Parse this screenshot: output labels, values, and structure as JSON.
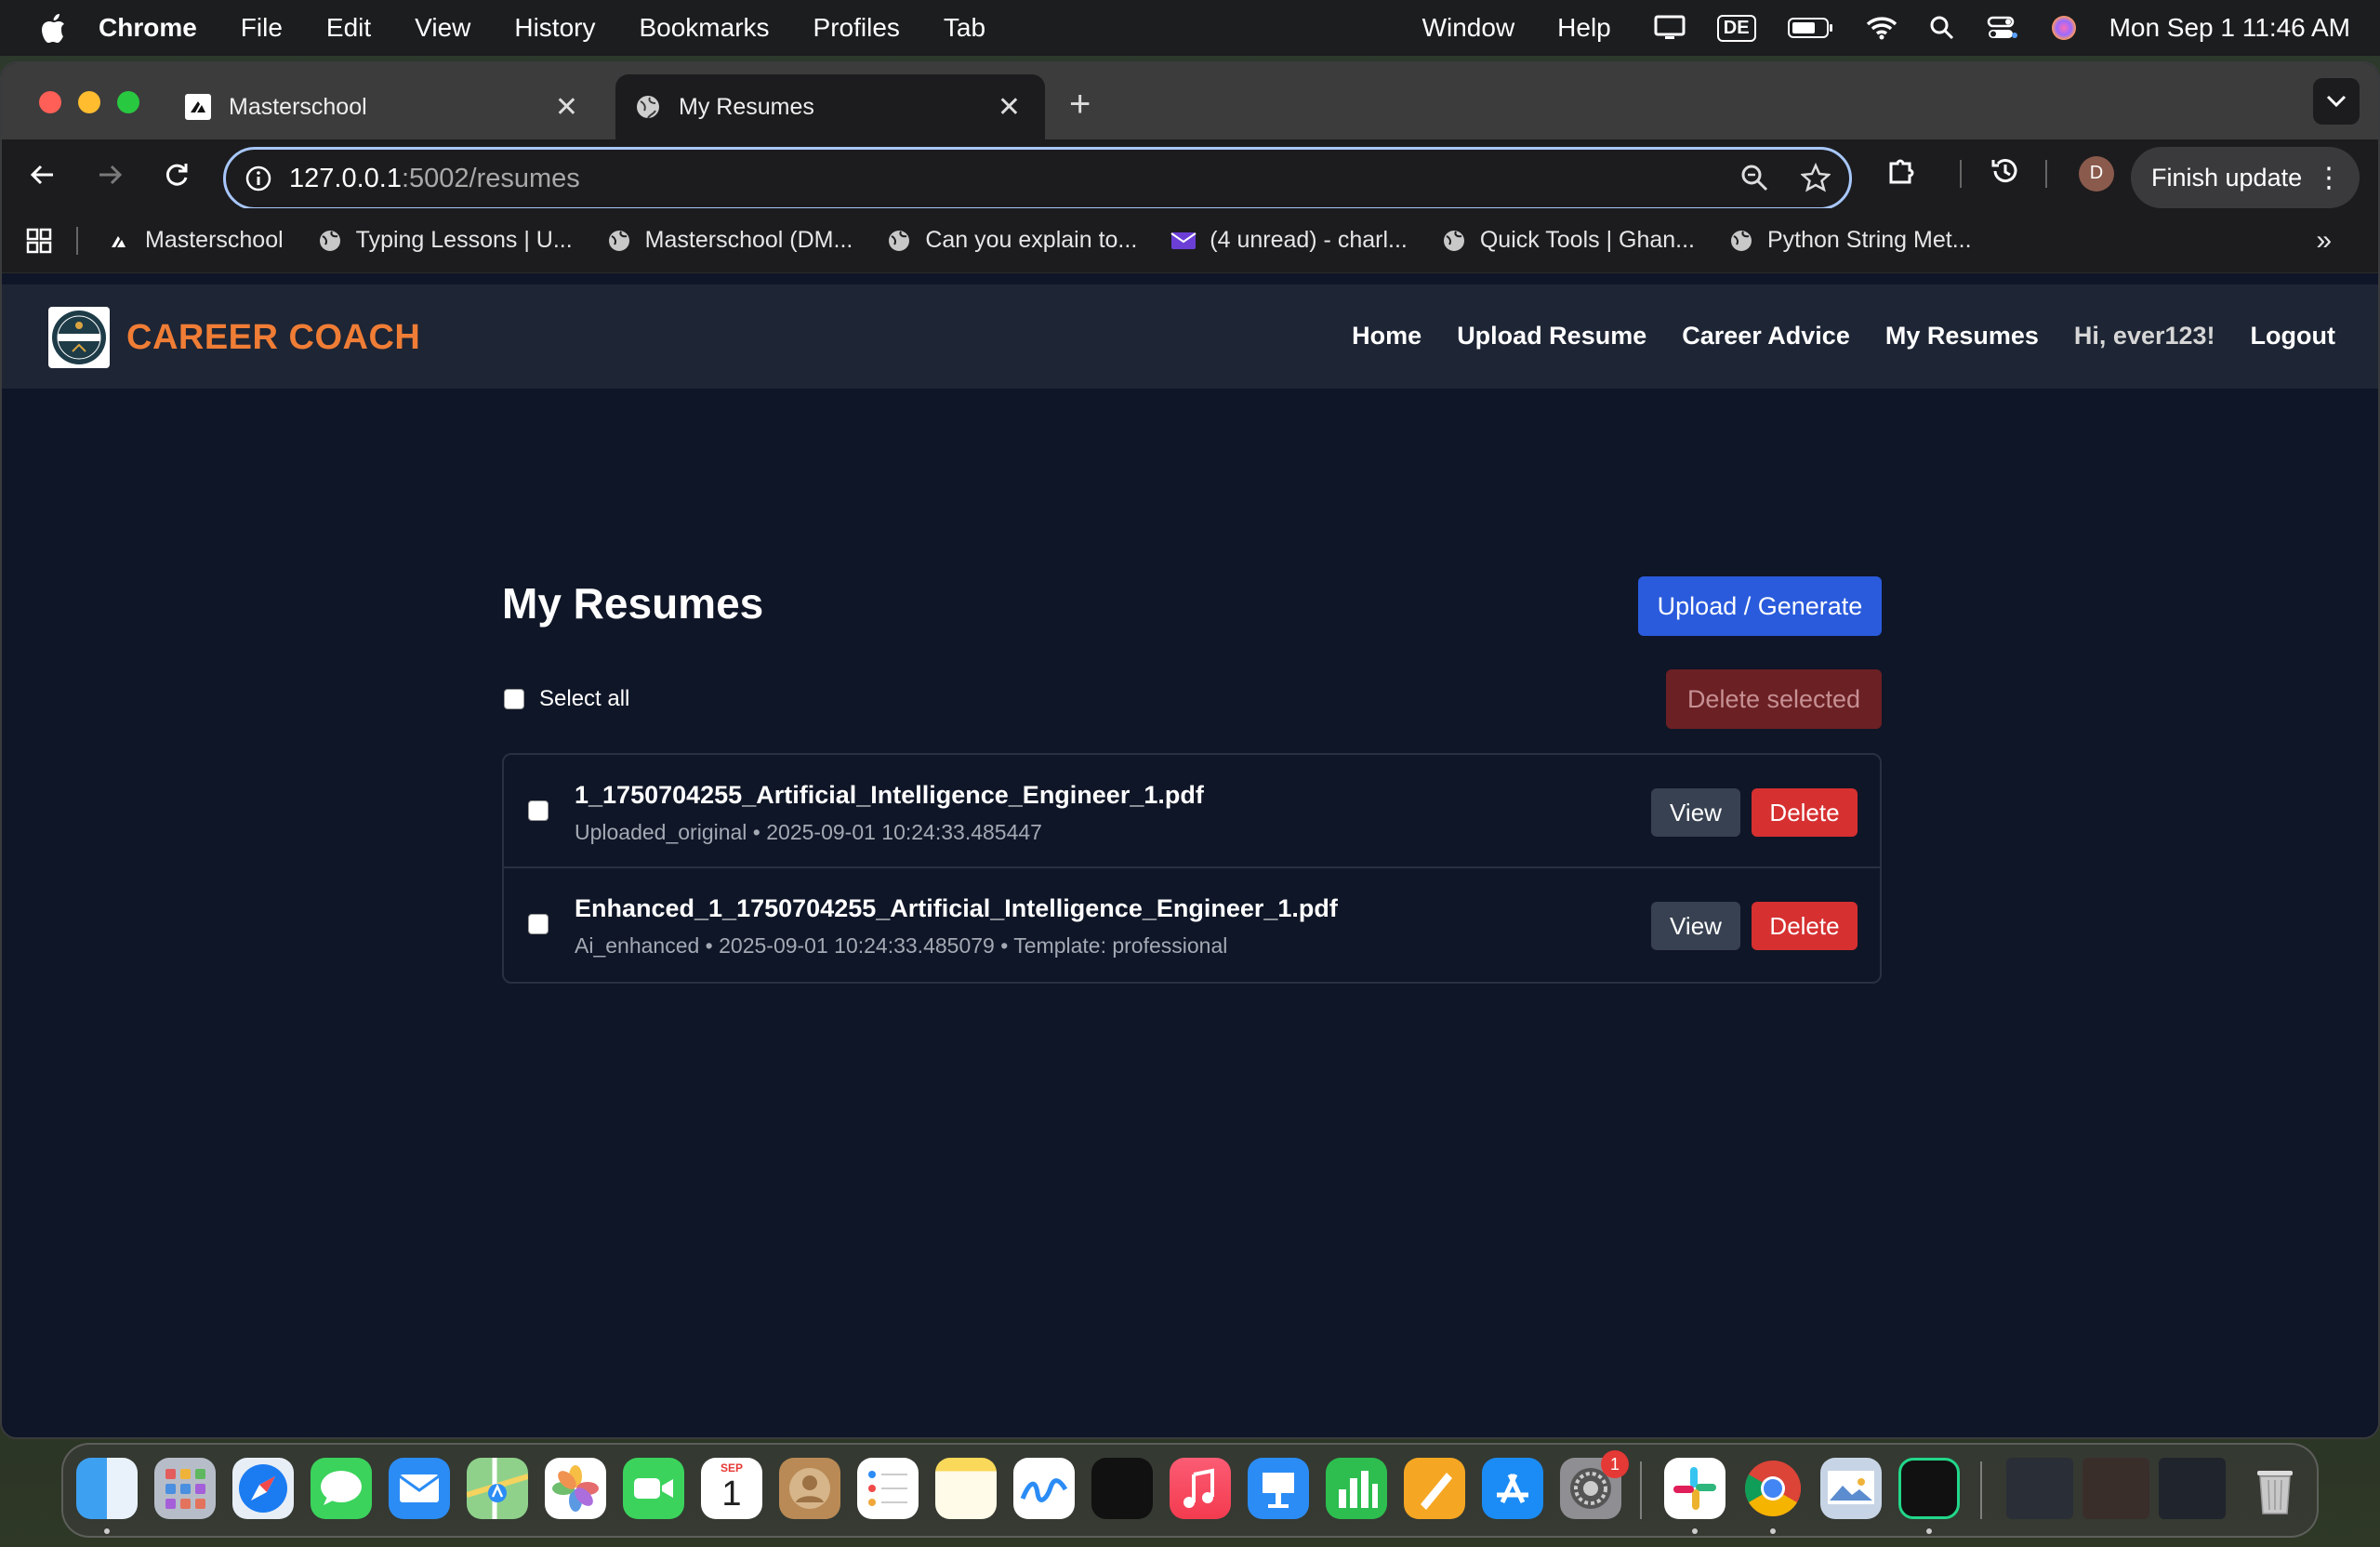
{
  "menubar": {
    "app": "Chrome",
    "items": [
      "File",
      "Edit",
      "View",
      "History",
      "Bookmarks",
      "Profiles",
      "Tab"
    ],
    "right_items": [
      "Window",
      "Help"
    ],
    "keyboard": "DE",
    "clock": "Mon Sep 1  11:46 AM"
  },
  "browser": {
    "tabs": [
      {
        "title": "Masterschool",
        "active": false
      },
      {
        "title": "My Resumes",
        "active": true
      }
    ],
    "url_host": "127.0.0.1",
    "url_path": ":5002/resumes",
    "profile_initial": "D",
    "finish_update": "Finish update",
    "bookmarks": [
      "Masterschool",
      "Typing Lessons | U...",
      "Masterschool (DM...",
      "Can you explain to...",
      "(4 unread) - charl...",
      "Quick Tools | Ghan...",
      "Python String Met..."
    ]
  },
  "app": {
    "brand": "CAREER COACH",
    "logo_text": "CAREER COACH",
    "nav": {
      "home": "Home",
      "upload": "Upload Resume",
      "advice": "Career Advice",
      "resumes": "My Resumes",
      "greeting": "Hi, ever123!",
      "logout": "Logout"
    },
    "page_title": "My Resumes",
    "upload_button": "Upload / Generate",
    "select_all": "Select all",
    "delete_selected": "Delete selected",
    "resumes": [
      {
        "filename": "1_1750704255_Artificial_Intelligence_Engineer_1.pdf",
        "meta": "Uploaded_original • 2025-09-01 10:24:33.485447",
        "view": "View",
        "delete": "Delete"
      },
      {
        "filename": "Enhanced_1_1750704255_Artificial_Intelligence_Engineer_1.pdf",
        "meta": "Ai_enhanced • 2025-09-01 10:24:33.485079 • Template: professional",
        "view": "View",
        "delete": "Delete"
      }
    ]
  },
  "dock": {
    "calendar_month": "SEP",
    "calendar_day": "1",
    "settings_badge": "1",
    "apps": [
      "finder-icon",
      "launchpad-icon",
      "safari-icon",
      "messages-icon",
      "mail-icon",
      "maps-icon",
      "photos-icon",
      "facetime-icon",
      "calendar-icon",
      "contacts-icon",
      "reminders-icon",
      "notes-icon",
      "freeform-icon",
      "tv-icon",
      "music-icon",
      "keynote-icon",
      "numbers-icon",
      "pages-icon",
      "app-store-icon",
      "system-settings-icon",
      "slack-icon",
      "chrome-icon",
      "preview-icon",
      "pycharm-icon",
      "trash-icon"
    ]
  },
  "colors": {
    "brand_orange": "#f07d35",
    "primary_blue": "#2a5bdc",
    "danger_red": "#d63031",
    "page_bg": "#0f1627"
  }
}
